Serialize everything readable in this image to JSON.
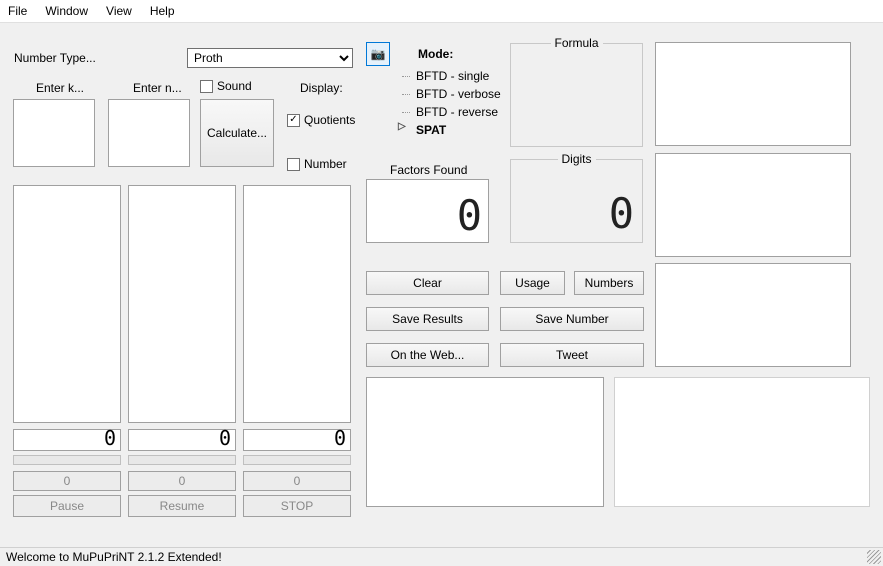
{
  "menu": {
    "file": "File",
    "window": "Window",
    "view": "View",
    "help": "Help"
  },
  "labels": {
    "numberType": "Number Type...",
    "enterK": "Enter k...",
    "enterN": "Enter n...",
    "sound": "Sound",
    "display": "Display:",
    "quotients": "Quotients",
    "number": "Number",
    "mode": "Mode:",
    "factorsFound": "Factors Found",
    "formula": "Formula",
    "digits": "Digits"
  },
  "combo": {
    "numberType": "Proth"
  },
  "tree": {
    "items": [
      {
        "label": "BFTD - single",
        "selected": false
      },
      {
        "label": "BFTD - verbose",
        "selected": false
      },
      {
        "label": "BFTD - reverse",
        "selected": false
      },
      {
        "label": "SPAT",
        "selected": true
      }
    ]
  },
  "lcd": {
    "factors": "0",
    "digits": "0"
  },
  "buttons": {
    "calculate": "Calculate...",
    "clear": "Clear",
    "usage": "Usage",
    "numbers": "Numbers",
    "saveResults": "Save Results",
    "saveNumber": "Save Number",
    "onTheWeb": "On the Web...",
    "tweet": "Tweet",
    "pause": "Pause",
    "resume": "Resume",
    "stop": "STOP"
  },
  "counters": {
    "a": "0",
    "b": "0",
    "c": "0"
  },
  "segs": {
    "a": "0",
    "b": "0",
    "c": "0"
  },
  "status": "Welcome to MuPuPriNT 2.1.2 Extended!",
  "checks": {
    "sound": false,
    "quotients": true,
    "number": false
  }
}
